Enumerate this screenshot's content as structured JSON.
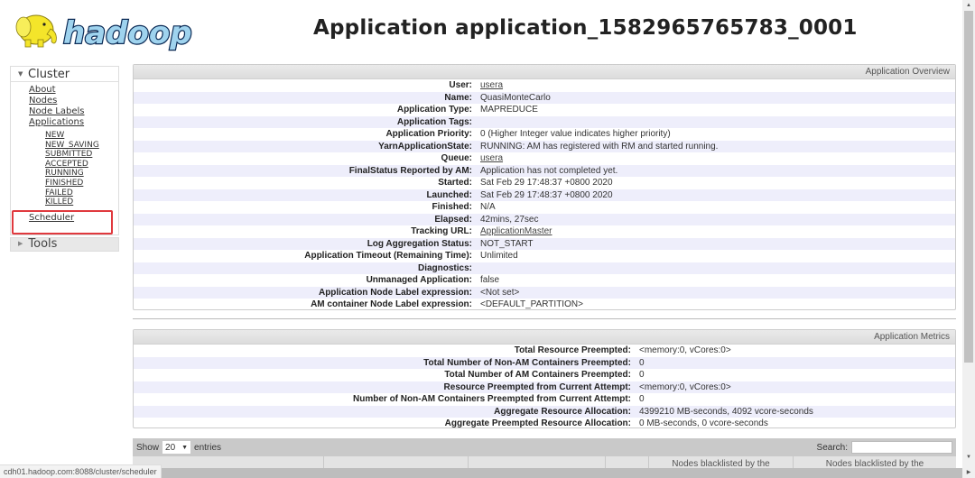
{
  "header": {
    "logo_text": "hadoop",
    "title": "Application application_1582965765783_0001"
  },
  "sidebar": {
    "cluster": {
      "label": "Cluster",
      "items": [
        {
          "label": "About"
        },
        {
          "label": "Nodes"
        },
        {
          "label": "Node Labels"
        },
        {
          "label": "Applications"
        }
      ],
      "app_states": [
        {
          "label": "NEW"
        },
        {
          "label": "NEW_SAVING"
        },
        {
          "label": "SUBMITTED"
        },
        {
          "label": "ACCEPTED"
        },
        {
          "label": "RUNNING"
        },
        {
          "label": "FINISHED"
        },
        {
          "label": "FAILED"
        },
        {
          "label": "KILLED"
        }
      ],
      "scheduler": "Scheduler"
    },
    "tools": {
      "label": "Tools"
    },
    "highlight_color": "#e0393e"
  },
  "overview": {
    "caption": "Application Overview",
    "rows": [
      {
        "key": "User:",
        "value": "usera"
      },
      {
        "key": "Name:",
        "value": "QuasiMonteCarlo"
      },
      {
        "key": "Application Type:",
        "value": "MAPREDUCE"
      },
      {
        "key": "Application Tags:",
        "value": ""
      },
      {
        "key": "Application Priority:",
        "value": "0 (Higher Integer value indicates higher priority)"
      },
      {
        "key": "YarnApplicationState:",
        "value": "RUNNING: AM has registered with RM and started running."
      },
      {
        "key": "Queue:",
        "value": "usera"
      },
      {
        "key": "FinalStatus Reported by AM:",
        "value": "Application has not completed yet."
      },
      {
        "key": "Started:",
        "value": "Sat Feb 29 17:48:37 +0800 2020"
      },
      {
        "key": "Launched:",
        "value": "Sat Feb 29 17:48:37 +0800 2020"
      },
      {
        "key": "Finished:",
        "value": "N/A"
      },
      {
        "key": "Elapsed:",
        "value": "42mins, 27sec"
      },
      {
        "key": "Tracking URL:",
        "value": "ApplicationMaster"
      },
      {
        "key": "Log Aggregation Status:",
        "value": "NOT_START"
      },
      {
        "key": "Application Timeout (Remaining Time):",
        "value": "Unlimited"
      },
      {
        "key": "Diagnostics:",
        "value": ""
      },
      {
        "key": "Unmanaged Application:",
        "value": "false"
      },
      {
        "key": "Application Node Label expression:",
        "value": "<Not set>"
      },
      {
        "key": "AM container Node Label expression:",
        "value": "<DEFAULT_PARTITION>"
      }
    ]
  },
  "metrics": {
    "caption": "Application Metrics",
    "rows": [
      {
        "key": "Total Resource Preempted:",
        "value": "<memory:0, vCores:0>"
      },
      {
        "key": "Total Number of Non-AM Containers Preempted:",
        "value": "0"
      },
      {
        "key": "Total Number of AM Containers Preempted:",
        "value": "0"
      },
      {
        "key": "Resource Preempted from Current Attempt:",
        "value": "<memory:0, vCores:0>"
      },
      {
        "key": "Number of Non-AM Containers Preempted from Current Attempt:",
        "value": "0"
      },
      {
        "key": "Aggregate Resource Allocation:",
        "value": "4399210 MB-seconds, 4092 vcore-seconds"
      },
      {
        "key": "Aggregate Preempted Resource Allocation:",
        "value": "0 MB-seconds, 0 vcore-seconds"
      }
    ]
  },
  "table": {
    "show_label": "Show",
    "page_length": "20",
    "entries_label": "entries",
    "search_label": "Search:",
    "search_value": "",
    "headers": [
      "",
      "",
      "",
      "",
      "",
      "Nodes blacklisted by the",
      "Nodes blacklisted by the"
    ]
  },
  "status_bar": {
    "url": "cdh01.hadoop.com:8088/cluster/scheduler"
  }
}
